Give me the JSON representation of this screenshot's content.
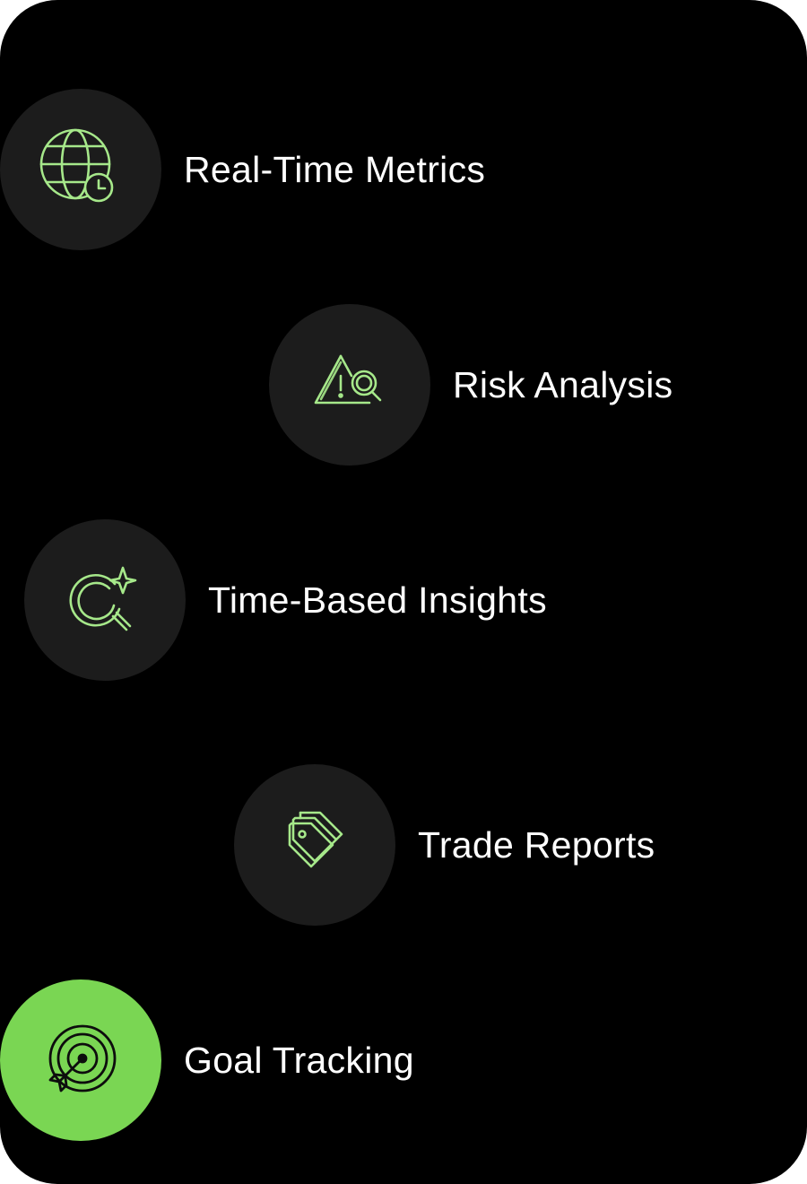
{
  "colors": {
    "background": "#000000",
    "circle": "#1c1c1c",
    "accent": "#7ad653",
    "icon_stroke": "#a6e88a",
    "text": "#ffffff"
  },
  "features": [
    {
      "label": "Real-Time Metrics",
      "icon": "globe-clock-icon",
      "active": false
    },
    {
      "label": "Risk Analysis",
      "icon": "warning-search-icon",
      "active": false
    },
    {
      "label": "Time-Based Insights",
      "icon": "sparkle-search-icon",
      "active": false
    },
    {
      "label": "Trade Reports",
      "icon": "tags-icon",
      "active": false
    },
    {
      "label": "Goal Tracking",
      "icon": "target-icon",
      "active": true
    }
  ]
}
